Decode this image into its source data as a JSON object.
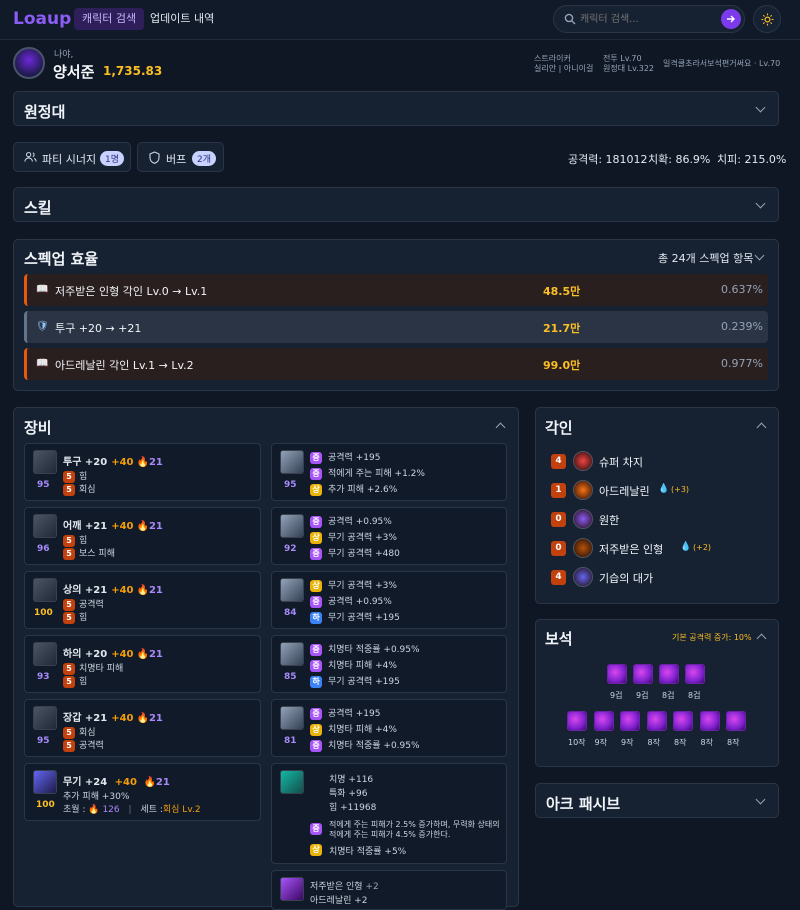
{
  "app": {
    "logo": "Loaup"
  },
  "nav": {
    "tab_search": "캐릭터 검색",
    "tab_updates": "업데이트 내역"
  },
  "search": {
    "placeholder": "캐릭터 검색..."
  },
  "profile": {
    "greeting": "나야,",
    "name": "양서준",
    "item_level": "1,735.83",
    "class": "스트라이커",
    "server": "실리안 | 아니이걸",
    "combat_lv": "전투 Lv.70",
    "expedition_lv": "원정대 Lv.322",
    "guild": "일격쿨초라서보석편거써요 · Lv.70"
  },
  "sections": {
    "expedition": "원정대",
    "skill": "스킬",
    "specup": "스펙업 효율",
    "equipment": "장비",
    "engraving": "각인",
    "gems": "보석",
    "ark": "아크 패시브"
  },
  "buttons": {
    "party_synergy": "파티 시너지",
    "party_count": "1명",
    "buff": "버프",
    "buff_count": "2개"
  },
  "stats": {
    "attack": "공격력: 181012",
    "crit": "치확: 86.9%",
    "critdmg": "치피: 215.0%"
  },
  "specup": {
    "total": "총 24개 스펙업 항목",
    "items": [
      {
        "label": "저주받은 인형 각인 Lv.0 → Lv.1",
        "value": "48.5만",
        "pct": "0.637%",
        "color": "#ea580c"
      },
      {
        "label": "투구 +20 → +21",
        "value": "21.7만",
        "pct": "0.239%",
        "color": "#64748b"
      },
      {
        "label": "아드레날린 각인 Lv.1 → Lv.2",
        "value": "99.0만",
        "pct": "0.977%",
        "color": "#ea580c"
      }
    ]
  },
  "equipment": [
    {
      "name": "투구 +20",
      "bonus": "+40",
      "honing": "21",
      "quality": "95",
      "line1": "힘",
      "line2": "회심",
      "t1": "5",
      "t2": "5"
    },
    {
      "name": "어깨 +21",
      "bonus": "+40",
      "honing": "21",
      "quality": "96",
      "line1": "힘",
      "line2": "보스 피해",
      "t1": "5",
      "t2": "5"
    },
    {
      "name": "상의 +21",
      "bonus": "+40",
      "honing": "21",
      "quality": "100",
      "line1": "공격력",
      "line2": "힘",
      "t1": "5",
      "t2": "5"
    },
    {
      "name": "하의 +20",
      "bonus": "+40",
      "honing": "21",
      "quality": "93",
      "line1": "치명타 피해",
      "line2": "힘",
      "t1": "5",
      "t2": "5"
    },
    {
      "name": "장갑 +21",
      "bonus": "+40",
      "honing": "21",
      "quality": "95",
      "line1": "회심",
      "line2": "공격력",
      "t1": "5",
      "t2": "5"
    }
  ],
  "weapon": {
    "name": "무기 +24",
    "bonus": "+40",
    "honing": "21",
    "quality": "100",
    "extra": "추가 피해 +30%",
    "transcend_label": "초월 :",
    "transcend": "126",
    "set_label": "세트 :",
    "set": "회심 Lv.2"
  },
  "accessories": [
    {
      "quality": "95",
      "lines": [
        {
          "t": "중",
          "c": "#a855f7",
          "s": "공격력 +195"
        },
        {
          "t": "중",
          "c": "#a855f7",
          "s": "적에게 주는 피해 +1.2%"
        },
        {
          "t": "상",
          "c": "#eab308",
          "s": "추가 피해 +2.6%"
        }
      ]
    },
    {
      "quality": "92",
      "lines": [
        {
          "t": "중",
          "c": "#a855f7",
          "s": "공격력 +0.95%"
        },
        {
          "t": "상",
          "c": "#eab308",
          "s": "무기 공격력 +3%"
        },
        {
          "t": "중",
          "c": "#a855f7",
          "s": "무기 공격력 +480"
        }
      ]
    },
    {
      "quality": "84",
      "lines": [
        {
          "t": "상",
          "c": "#eab308",
          "s": "무기 공격력 +3%"
        },
        {
          "t": "중",
          "c": "#a855f7",
          "s": "공격력 +0.95%"
        },
        {
          "t": "하",
          "c": "#3b82f6",
          "s": "무기 공격력 +195"
        }
      ]
    },
    {
      "quality": "85",
      "lines": [
        {
          "t": "중",
          "c": "#a855f7",
          "s": "치명타 적중률 +0.95%"
        },
        {
          "t": "중",
          "c": "#a855f7",
          "s": "치명타 피해 +4%"
        },
        {
          "t": "하",
          "c": "#3b82f6",
          "s": "무기 공격력 +195"
        }
      ]
    },
    {
      "quality": "81",
      "lines": [
        {
          "t": "중",
          "c": "#a855f7",
          "s": "공격력 +195"
        },
        {
          "t": "상",
          "c": "#eab308",
          "s": "치명타 피해 +4%"
        },
        {
          "t": "중",
          "c": "#a855f7",
          "s": "치명타 적중률 +0.95%"
        }
      ]
    }
  ],
  "bracelet": {
    "stats": [
      "치명 +116",
      "특화 +96",
      "힘 +11968"
    ],
    "effect_tier": "중",
    "effect": "적에게 주는 피해가 2.5% 증가하며, 무력화 상태의 적에게 주는 피해가 4.5% 증가한다.",
    "effect2_tier": "상",
    "effect2": "치명타 적중률 +5%"
  },
  "stone": {
    "line1": "저주받은 인형",
    "line1_val": "+2",
    "line2": "아드레날린 +2"
  },
  "engravings": [
    {
      "level": "4",
      "name": "슈퍼 차지",
      "extra": ""
    },
    {
      "level": "1",
      "name": "아드레날린",
      "extra": "(+3)"
    },
    {
      "level": "0",
      "name": "원한",
      "extra": ""
    },
    {
      "level": "0",
      "name": "저주받은 인형",
      "extra": "(+2)"
    },
    {
      "level": "4",
      "name": "기습의 대가",
      "extra": ""
    }
  ],
  "gems": {
    "header_label": "기본 공격력 증가: 10%",
    "row1": [
      "9겁",
      "9겁",
      "8겁",
      "8겁"
    ],
    "row2": [
      "10작",
      "9작",
      "9작",
      "8작",
      "8작",
      "8작",
      "8작"
    ]
  },
  "colors": {
    "accent": "#8b5cf6",
    "gold": "#f59e0b",
    "bg": "#0f1724",
    "panel": "#162132"
  }
}
